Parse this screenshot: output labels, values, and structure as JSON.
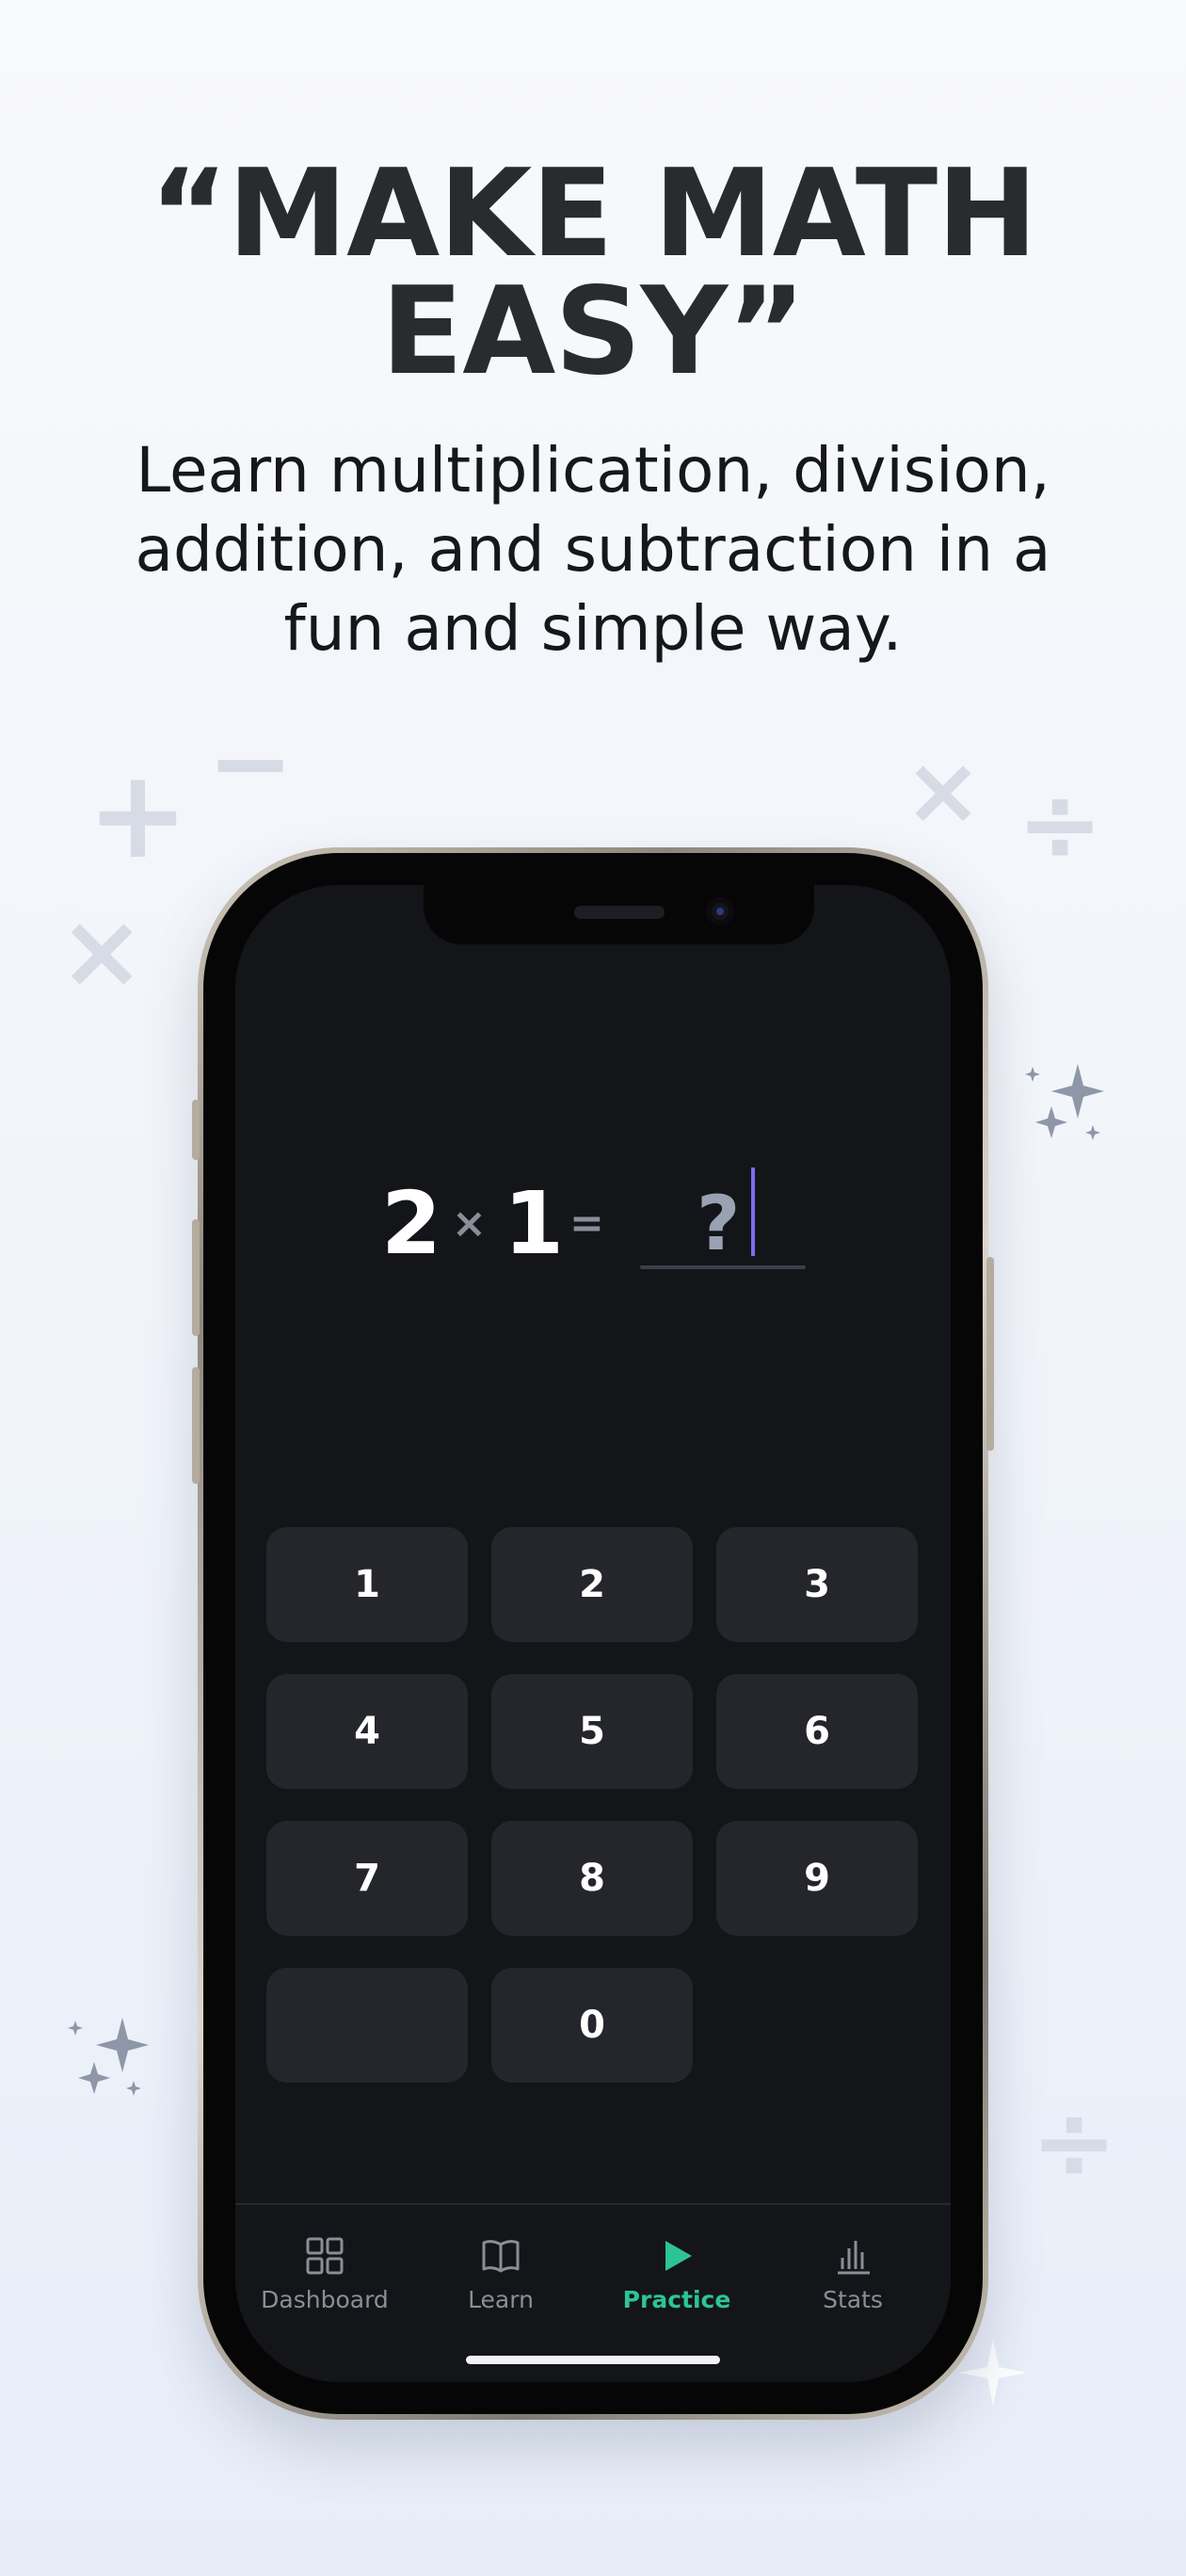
{
  "header": {
    "headline_line1": "“MAKE MATH",
    "headline_line2": "EASY”",
    "subtitle_line1": "Learn multiplication, division,",
    "subtitle_line2": "addition, and subtraction in a",
    "subtitle_line3": "fun and simple way."
  },
  "equation": {
    "operand1": "2",
    "operator": "×",
    "operand2": "1",
    "equals": "=",
    "answer_placeholder": "?"
  },
  "keypad": {
    "keys": [
      "1",
      "2",
      "3",
      "4",
      "5",
      "6",
      "7",
      "8",
      "9",
      "",
      "0"
    ]
  },
  "tabs": [
    {
      "label": "Dashboard",
      "icon": "grid-icon",
      "active": false
    },
    {
      "label": "Learn",
      "icon": "book-icon",
      "active": false
    },
    {
      "label": "Practice",
      "icon": "play-icon",
      "active": true
    },
    {
      "label": "Stats",
      "icon": "bar-chart-icon",
      "active": false
    }
  ],
  "decorations": {
    "plus": "+",
    "minus": "−",
    "times": "×",
    "divide": "÷"
  },
  "colors": {
    "accent": "#2cc497",
    "cursor": "#7b6cf0",
    "screen_bg": "#141518",
    "key_bg": "#24262c",
    "headline": "#2a2b2f"
  }
}
